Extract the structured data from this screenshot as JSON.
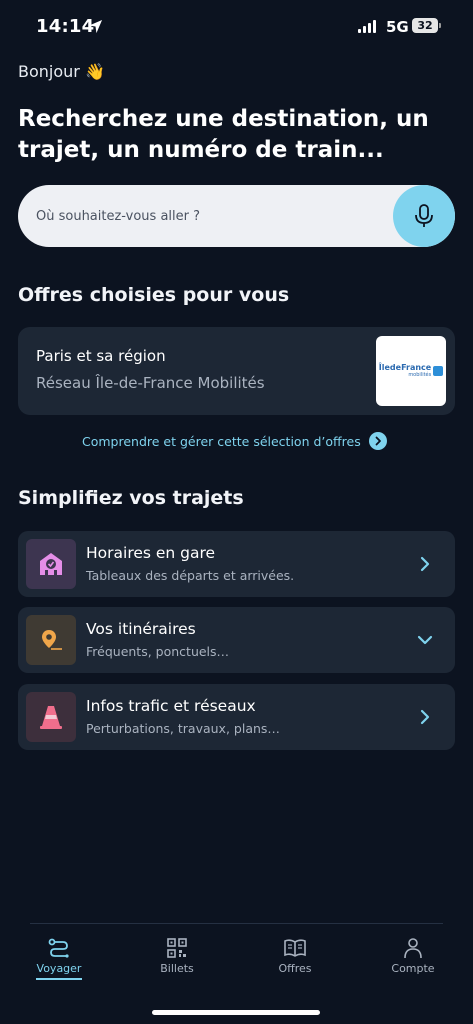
{
  "status_bar": {
    "time": "14:14",
    "network": "5G",
    "battery": "32",
    "location_icon": "location-arrow-icon",
    "signal_icon": "signal-bars-icon"
  },
  "greeting": "Bonjour 👋",
  "headline": "Recherchez une destination, un trajet, un numéro de train...",
  "search": {
    "placeholder": "Où souhaitez-vous aller ?",
    "value": "",
    "mic_icon": "microphone-icon"
  },
  "offers_section": {
    "title": "Offres choisies pour vous",
    "card": {
      "title": "Paris et sa région",
      "subtitle": "Réseau Île-de-France Mobilités",
      "logo_text": "ÎledeFrance",
      "logo_sub": "mobilités"
    },
    "manage_link": "Comprendre et gérer cette sélection d’offres"
  },
  "simplify_section": {
    "title": "Simplifiez vos trajets",
    "items": [
      {
        "title": "Horaires en gare",
        "subtitle": "Tableaux des départs et arrivées.",
        "icon": "station-clock-icon",
        "chevron": "chevron-right-icon",
        "icon_color": "#e58ee8",
        "icon_bg": "#3d3550"
      },
      {
        "title": "Vos itinéraires",
        "subtitle": "Fréquents, ponctuels…",
        "icon": "map-pin-icon",
        "chevron": "chevron-down-icon",
        "icon_color": "#f0a64a",
        "icon_bg": "#3f3a33"
      },
      {
        "title": "Infos trafic et réseaux",
        "subtitle": "Perturbations, travaux, plans…",
        "icon": "traffic-cone-icon",
        "chevron": "chevron-right-icon",
        "icon_color": "#f06e8c",
        "icon_bg": "#3d2f3c"
      }
    ]
  },
  "bottom_nav": {
    "items": [
      {
        "label": "Voyager",
        "icon": "route-icon",
        "active": true
      },
      {
        "label": "Billets",
        "icon": "qr-code-icon",
        "active": false
      },
      {
        "label": "Offres",
        "icon": "book-open-icon",
        "active": false
      },
      {
        "label": "Compte",
        "icon": "user-icon",
        "active": false
      }
    ]
  },
  "colors": {
    "background": "#0c1320",
    "card": "#1d2735",
    "accent": "#7fd3ee",
    "muted_text": "#aab3c0"
  }
}
